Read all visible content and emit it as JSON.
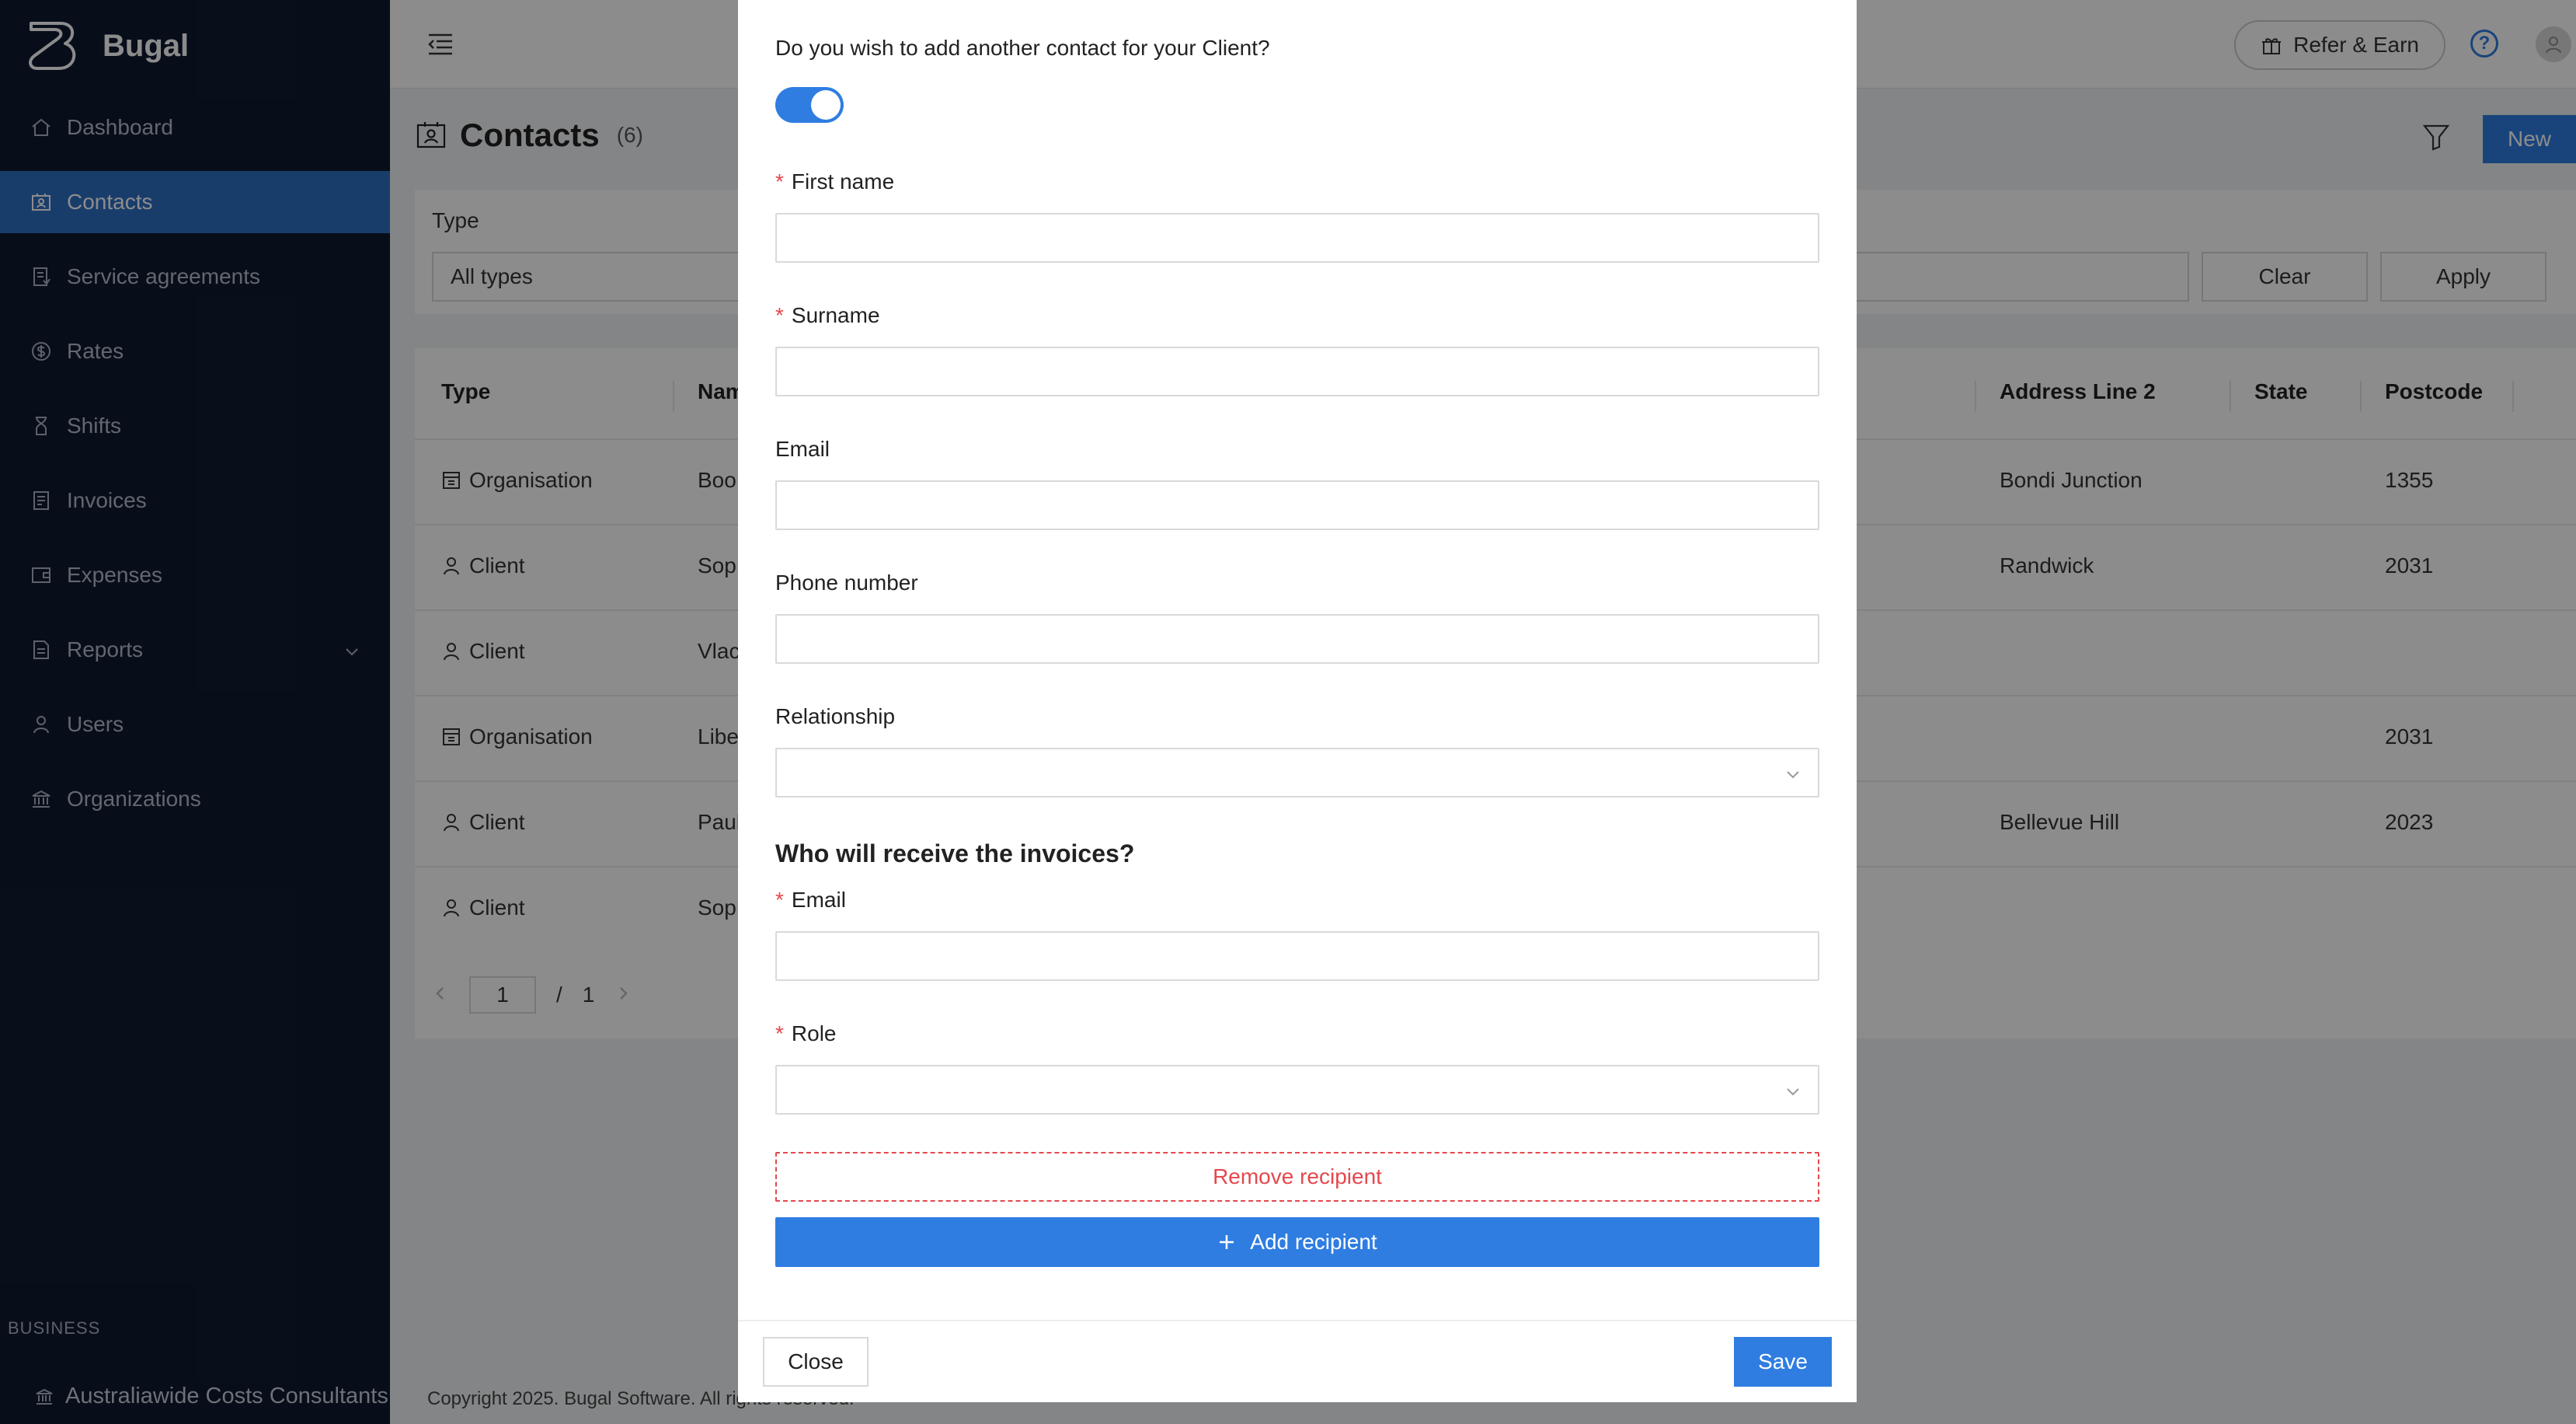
{
  "app": {
    "name": "Bugal"
  },
  "sidebar": {
    "items": [
      {
        "label": "Dashboard",
        "icon": "home-icon",
        "active": false
      },
      {
        "label": "Contacts",
        "icon": "contacts-icon",
        "active": true
      },
      {
        "label": "Service agreements",
        "icon": "document-icon",
        "active": false
      },
      {
        "label": "Rates",
        "icon": "dollar-icon",
        "active": false
      },
      {
        "label": "Shifts",
        "icon": "hourglass-icon",
        "active": false
      },
      {
        "label": "Invoices",
        "icon": "invoice-icon",
        "active": false
      },
      {
        "label": "Expenses",
        "icon": "wallet-icon",
        "active": false
      },
      {
        "label": "Reports",
        "icon": "report-icon",
        "active": false,
        "expandable": true
      },
      {
        "label": "Users",
        "icon": "user-icon",
        "active": false
      },
      {
        "label": "Organizations",
        "icon": "bank-icon",
        "active": false
      }
    ],
    "business_label": "BUSINESS",
    "business_name": "Australiawide Costs Consultants"
  },
  "topbar": {
    "refer_label": "Refer & Earn"
  },
  "page": {
    "title": "Contacts",
    "count": "(6)",
    "new_label": "New",
    "filter": {
      "type_label": "Type",
      "type_value": "All types",
      "clear_label": "Clear",
      "apply_label": "Apply"
    },
    "table": {
      "columns": [
        "Type",
        "Nam",
        "Address Line 2",
        "State",
        "Postcode"
      ],
      "rows": [
        {
          "type": "Organisation",
          "name": "Boo",
          "address2": "Bondi Junction",
          "state": "",
          "postcode": "1355"
        },
        {
          "type": "Client",
          "name": "Sop",
          "address2": "Randwick",
          "state": "",
          "postcode": "2031"
        },
        {
          "type": "Client",
          "name": "Vlac",
          "address2": "",
          "state": "",
          "postcode": ""
        },
        {
          "type": "Organisation",
          "name": "Libe",
          "address2": "",
          "state": "",
          "postcode": "2031"
        },
        {
          "type": "Client",
          "name": "Paul",
          "address2": "Bellevue Hill",
          "state": "",
          "postcode": "2023"
        },
        {
          "type": "Client",
          "name": "Sop",
          "address2": "",
          "state": "",
          "postcode": ""
        }
      ]
    },
    "pager": {
      "current": "1",
      "separator": "/",
      "total": "1"
    },
    "footer": "Copyright 2025. Bugal Software. All rights reserved."
  },
  "modal": {
    "question": "Do you wish to add another contact for your Client?",
    "toggle_on": true,
    "fields": {
      "first_name": {
        "label": "First name",
        "value": ""
      },
      "surname": {
        "label": "Surname",
        "value": ""
      },
      "email": {
        "label": "Email",
        "value": ""
      },
      "phone": {
        "label": "Phone number",
        "value": ""
      },
      "relationship": {
        "label": "Relationship",
        "value": ""
      }
    },
    "recipients_title": "Who will receive the invoices?",
    "recipient": {
      "email_label": "Email",
      "email_value": "",
      "role_label": "Role",
      "role_value": ""
    },
    "remove_label": "Remove recipient",
    "add_label": "Add recipient",
    "close_label": "Close",
    "save_label": "Save"
  },
  "colors": {
    "primary": "#2f7de1",
    "sidebar_bg": "#0e1b31",
    "danger": "#e5484d"
  }
}
